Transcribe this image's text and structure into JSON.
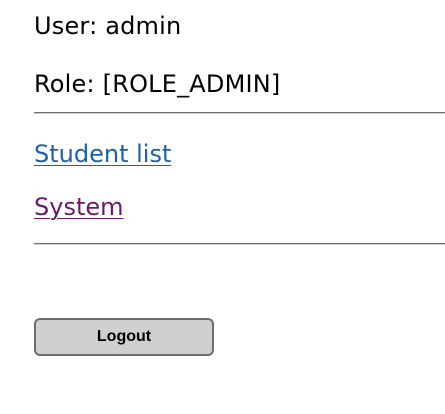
{
  "user": {
    "label": "User: admin",
    "role_label": "Role: [ROLE_ADMIN]"
  },
  "nav": {
    "links": [
      {
        "label": "Student list",
        "color": "#1a62a8",
        "visited": false
      },
      {
        "label": "System",
        "color": "#6b1a6b",
        "visited": true
      }
    ]
  },
  "actions": {
    "logout_label": "Logout"
  },
  "colors": {
    "background": "#ffffff",
    "text": "#000000",
    "link": "#1a62a8",
    "visited_link": "#6b1a6b",
    "button_fill": "#cfcfcf",
    "button_border": "#6e6e6e",
    "divider": "#6e6e6e"
  }
}
